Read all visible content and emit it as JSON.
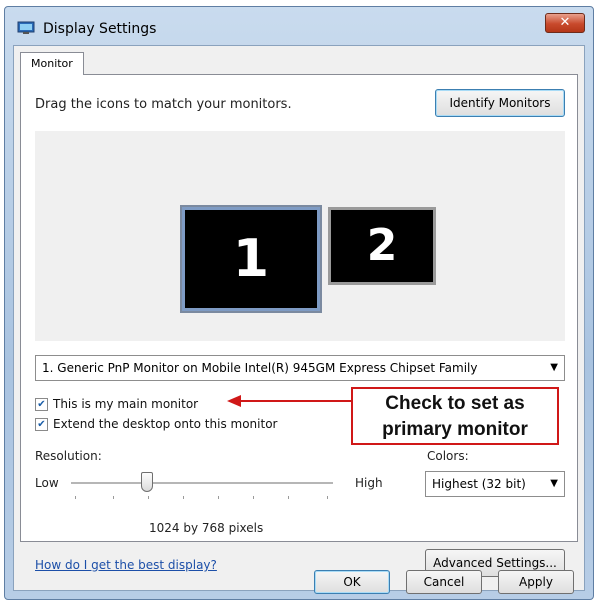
{
  "window": {
    "title": "Display Settings",
    "close_symbol": "✕"
  },
  "tabs": [
    {
      "label": "Monitor"
    }
  ],
  "monitor_panel": {
    "instruction": "Drag the icons to match your monitors.",
    "identify_label": "Identify Monitors",
    "monitors": [
      {
        "number": "1",
        "selected": true
      },
      {
        "number": "2",
        "selected": false
      }
    ],
    "monitor_select_value": "1. Generic PnP Monitor on Mobile Intel(R) 945GM Express Chipset Family",
    "main_monitor_label": "This is my main monitor",
    "main_monitor_checked": true,
    "extend_label": "Extend the desktop onto this monitor",
    "extend_checked": true,
    "resolution_label": "Resolution:",
    "low_label": "Low",
    "high_label": "High",
    "resolution_value": "1024 by 768 pixels",
    "colors_label": "Colors:",
    "colors_value": "Highest (32 bit)",
    "help_link": "How do I get the best display?",
    "advanced_label": "Advanced Settings..."
  },
  "callout": {
    "line1": "Check to set as",
    "line2": "primary monitor",
    "border_color": "#d01818"
  },
  "footer": {
    "ok_label": "OK",
    "cancel_label": "Cancel",
    "apply_label": "Apply"
  },
  "icons": {
    "window_icon": "display-icon",
    "dropdown": "chevron-down-icon",
    "check": "checkmark-icon"
  }
}
